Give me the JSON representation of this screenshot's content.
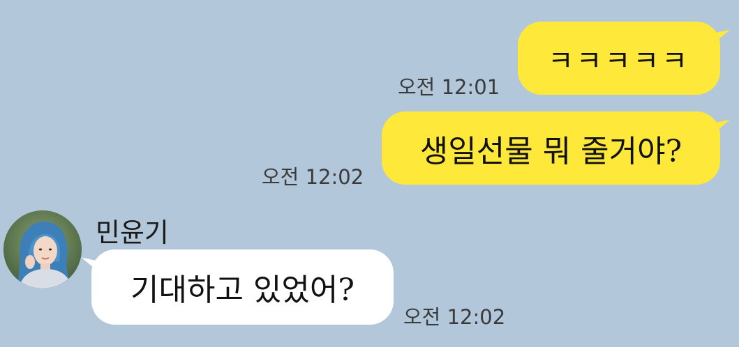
{
  "messages": [
    {
      "direction": "outgoing",
      "text": "ㅋㅋㅋㅋㅋ",
      "time": "오전 12:01"
    },
    {
      "direction": "outgoing",
      "text": "생일선물 뭐 줄거야?",
      "time": "오전 12:02"
    },
    {
      "direction": "incoming",
      "sender": "민윤기",
      "text": "기대하고 있었어?",
      "time": "오전 12:02"
    }
  ],
  "colors": {
    "background": "#b2c7da",
    "outgoing_bubble": "#fee93b",
    "incoming_bubble": "#ffffff"
  },
  "icons": {
    "avatar": "profile-photo"
  }
}
